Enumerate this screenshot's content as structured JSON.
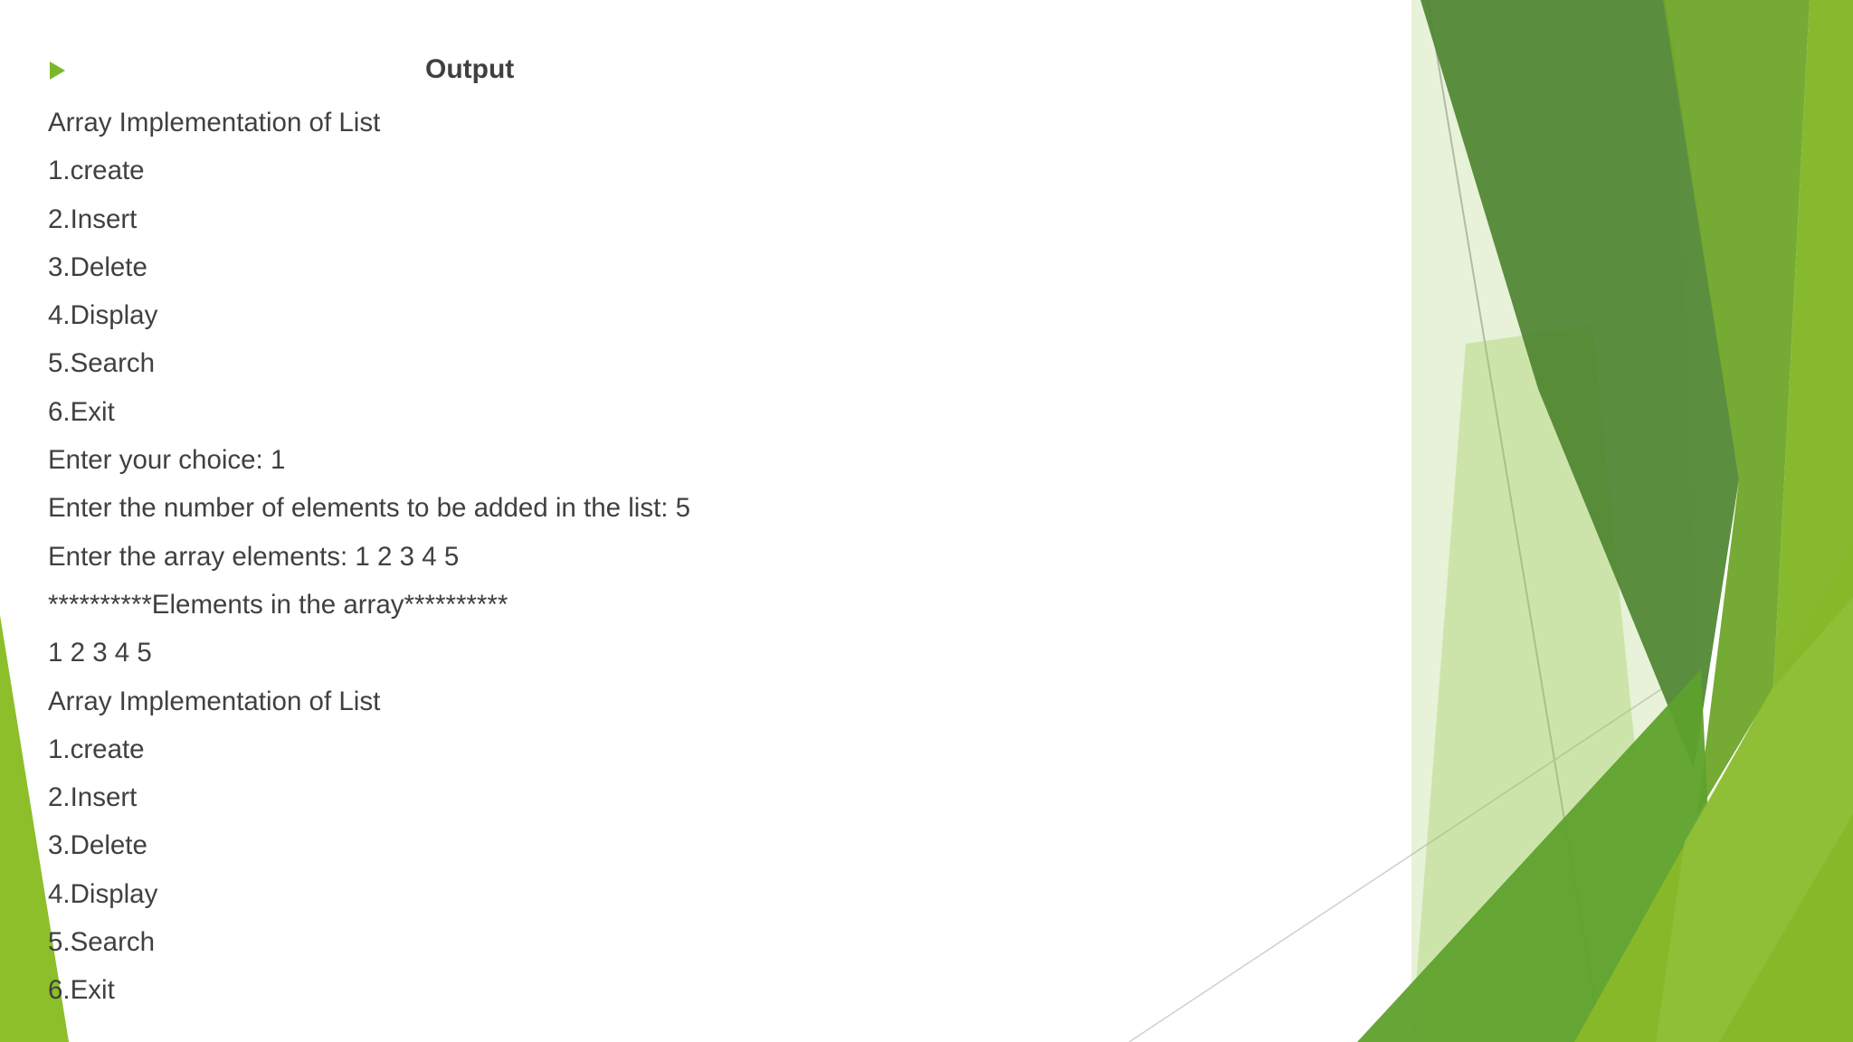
{
  "slide": {
    "title": "Output",
    "lines": [
      "Array Implementation of List",
      "1.create",
      "2.Insert",
      "3.Delete",
      "4.Display",
      "5.Search",
      "6.Exit",
      "Enter your choice: 1",
      "Enter the number of elements to be added in the list: 5",
      "Enter the array elements: 1 2 3 4 5",
      "**********Elements in the array**********",
      "1 2 3 4 5",
      "Array Implementation of List",
      "1.create",
      "2.Insert",
      "3.Delete",
      "4.Display",
      "5.Search",
      "6.Exit"
    ]
  },
  "theme": {
    "bullet_color": "#7ab829",
    "text_color": "#404040",
    "dark_green": "#4a7d2e",
    "mid_green": "#6aa32c",
    "light_green": "#8cbf2a"
  }
}
